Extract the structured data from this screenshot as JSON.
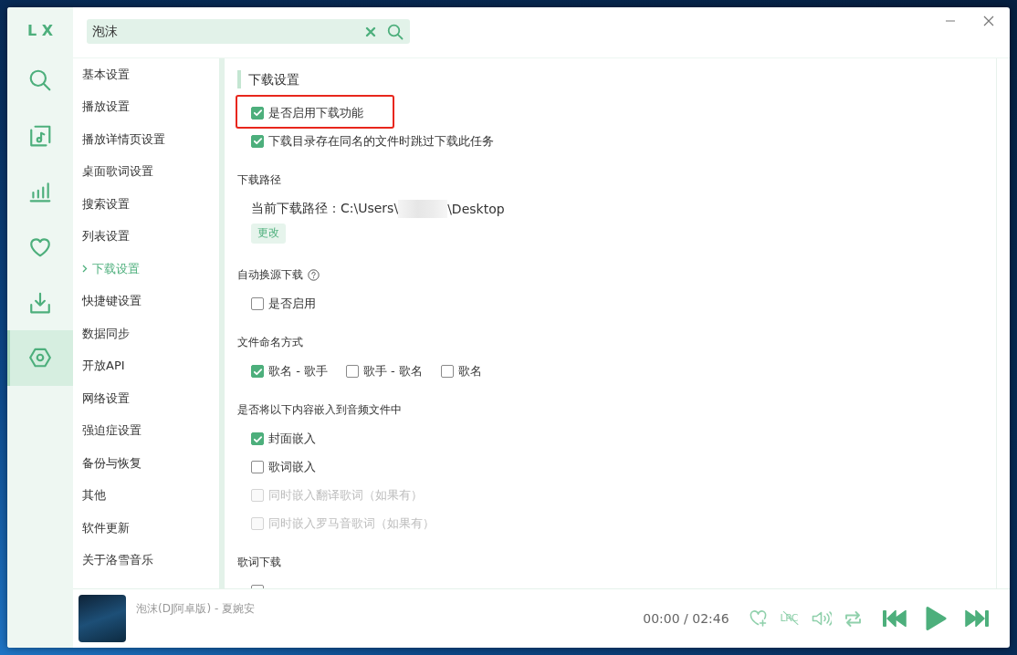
{
  "rail": {
    "logo": "L X",
    "items": [
      {
        "kind": "search",
        "selected": false
      },
      {
        "kind": "music",
        "selected": false
      },
      {
        "kind": "chart",
        "selected": false
      },
      {
        "kind": "heart",
        "selected": false
      },
      {
        "kind": "download",
        "selected": false
      },
      {
        "kind": "settings",
        "selected": true
      }
    ]
  },
  "search": {
    "value": "泡沫"
  },
  "nav": {
    "items": [
      {
        "label": "基本设置",
        "selected": false
      },
      {
        "label": "播放设置",
        "selected": false
      },
      {
        "label": "播放详情页设置",
        "selected": false
      },
      {
        "label": "桌面歌词设置",
        "selected": false
      },
      {
        "label": "搜索设置",
        "selected": false
      },
      {
        "label": "列表设置",
        "selected": false
      },
      {
        "label": "下载设置",
        "selected": true
      },
      {
        "label": "快捷键设置",
        "selected": false
      },
      {
        "label": "数据同步",
        "selected": false
      },
      {
        "label": "开放API",
        "selected": false
      },
      {
        "label": "网络设置",
        "selected": false
      },
      {
        "label": "强迫症设置",
        "selected": false
      },
      {
        "label": "备份与恢复",
        "selected": false
      },
      {
        "label": "其他",
        "selected": false
      },
      {
        "label": "软件更新",
        "selected": false
      },
      {
        "label": "关于洛雪音乐",
        "selected": false
      }
    ]
  },
  "settings": {
    "title": "下载设置",
    "top_options": [
      {
        "label": "是否启用下载功能",
        "checked": true,
        "highlighted": true
      },
      {
        "label": "下载目录存在同名的文件时跳过下载此任务",
        "checked": true,
        "highlighted": false
      }
    ],
    "sections": [
      {
        "kind": "path",
        "heading": "下载路径",
        "label": "当前下载路径：",
        "path_start": "C:\\Users\\",
        "redacted": true,
        "path_end": "\\Desktop",
        "button": "更改"
      },
      {
        "kind": "checks",
        "heading": "自动换源下载",
        "help": true,
        "options": [
          {
            "label": "是否启用",
            "checked": false,
            "disabled": false
          }
        ]
      },
      {
        "kind": "choices",
        "heading": "文件命名方式",
        "options": [
          {
            "label": "歌名 - 歌手",
            "selected": true
          },
          {
            "label": "歌手 - 歌名",
            "selected": false
          },
          {
            "label": "歌名",
            "selected": false
          }
        ]
      },
      {
        "kind": "checks",
        "heading": "是否将以下内容嵌入到音频文件中",
        "options": [
          {
            "label": "封面嵌入",
            "checked": true,
            "disabled": false
          },
          {
            "label": "歌词嵌入",
            "checked": false,
            "disabled": false
          },
          {
            "label": "同时嵌入翻译歌词（如果有）",
            "checked": false,
            "disabled": true
          },
          {
            "label": "同时嵌入罗马音歌词（如果有）",
            "checked": false,
            "disabled": true
          }
        ]
      },
      {
        "kind": "checks",
        "heading": "歌词下载",
        "options": [
          {
            "checked": false,
            "disabled": false
          }
        ]
      }
    ]
  },
  "player": {
    "title": "泡沫(DJ阿卓版) - 夏婉安",
    "time": "00:00 / 02:46",
    "lyrics": {
      "label": "LRC",
      "on": false
    }
  }
}
